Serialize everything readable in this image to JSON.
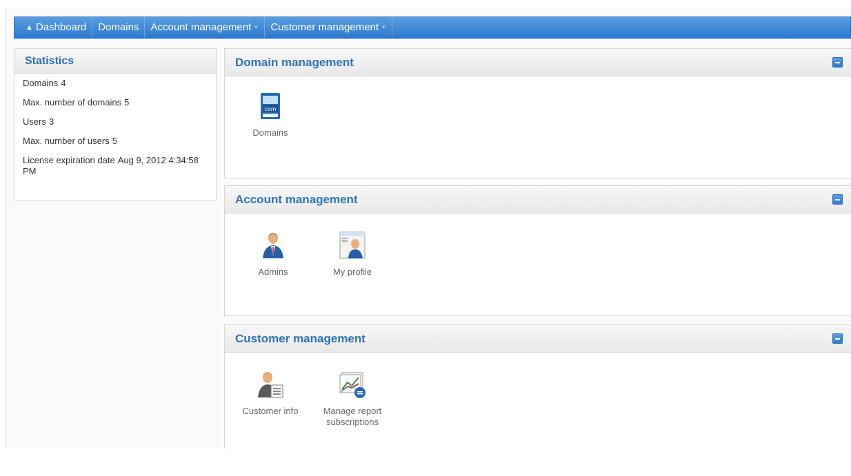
{
  "nav": {
    "items": [
      {
        "label": "Dashboard",
        "home": true
      },
      {
        "label": "Domains"
      },
      {
        "label": "Account management",
        "dropdown": true
      },
      {
        "label": "Customer management",
        "dropdown": true
      }
    ],
    "home_icon": "home-icon"
  },
  "statistics": {
    "title": "Statistics",
    "rows": [
      {
        "label": "Domains",
        "value": "4"
      },
      {
        "label": "Max. number of domains",
        "value": "5"
      },
      {
        "label": "Users",
        "value": "3"
      },
      {
        "label": "Max. number of users",
        "value": "5"
      },
      {
        "label": "License expiration date",
        "value": "Aug 9, 2012 4:34:58 PM"
      }
    ]
  },
  "panels": {
    "domain": {
      "title": "Domain management",
      "tiles": [
        {
          "label": "Domains",
          "icon": "domains-icon"
        }
      ]
    },
    "account": {
      "title": "Account management",
      "tiles": [
        {
          "label": "Admins",
          "icon": "admin-user-icon"
        },
        {
          "label": "My profile",
          "icon": "profile-icon"
        }
      ]
    },
    "customer": {
      "title": "Customer management",
      "tiles": [
        {
          "label": "Customer info",
          "icon": "customer-info-icon"
        },
        {
          "label": "Manage report subscriptions",
          "icon": "report-subscription-icon"
        }
      ]
    }
  },
  "colors": {
    "nav_bar": "#2d7ad0",
    "panel_title": "#2d72b8"
  }
}
